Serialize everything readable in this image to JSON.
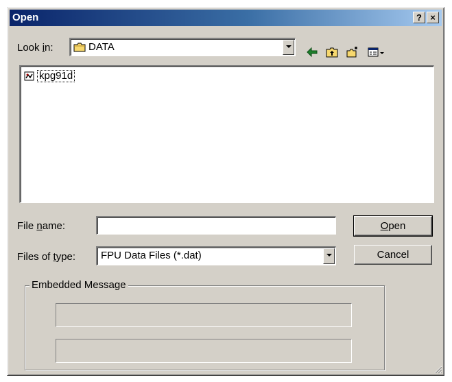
{
  "window": {
    "title": "Open",
    "help_label": "?",
    "close_label": "×"
  },
  "look_in": {
    "label_pre": "Look ",
    "label_access": "i",
    "label_post": "n:",
    "value": "DATA",
    "icon": "folder-icon"
  },
  "toolbar": {
    "icons": [
      "back-arrow-icon",
      "up-folder-icon",
      "new-folder-icon",
      "view-menu-icon"
    ],
    "colors": {
      "back_arrow": "#1e7f2c",
      "folder": "#f7d86e"
    }
  },
  "file_list": {
    "items": [
      {
        "name": "kpg91d",
        "icon": "data-file-icon"
      }
    ]
  },
  "file_name": {
    "label_pre": "File ",
    "label_access": "n",
    "label_post": "ame:",
    "value": ""
  },
  "file_type": {
    "label_pre": "Files of ",
    "label_access": "t",
    "label_post": "ype:",
    "value": "FPU Data Files (*.dat)"
  },
  "buttons": {
    "open_access": "O",
    "open_rest": "pen",
    "cancel": "Cancel"
  },
  "embedded": {
    "legend": "Embedded Message",
    "line1": "",
    "line2": ""
  }
}
